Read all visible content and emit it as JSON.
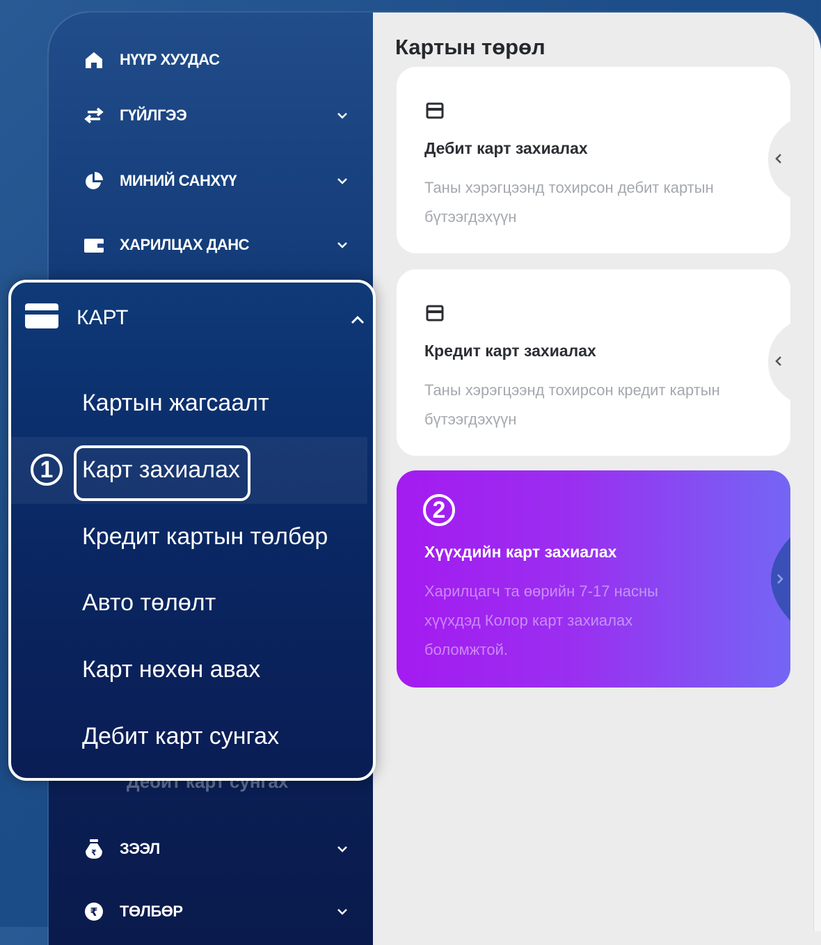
{
  "sidebar": {
    "items": [
      {
        "label": "НҮҮР ХУУДАС",
        "icon": "home-icon"
      },
      {
        "label": "ГҮЙЛГЭЭ",
        "icon": "transfer-icon"
      },
      {
        "label": "МИНИЙ САНХҮҮ",
        "icon": "pie-chart-icon"
      },
      {
        "label": "ХАРИЛЦАХ ДАНС",
        "icon": "wallet-icon"
      },
      {
        "label": "ЗЭЭЛ",
        "icon": "money-bag-icon"
      },
      {
        "label": "ТӨЛБӨР",
        "icon": "payment-icon"
      }
    ],
    "ghost_sub_label": "Дебит карт сунгах"
  },
  "card_menu": {
    "label": "КАРТ",
    "badge": "1",
    "items": [
      {
        "label": "Картын жагсаалт"
      },
      {
        "label": "Карт захиалах"
      },
      {
        "label": "Кредит картын төлбөр"
      },
      {
        "label": "Авто төлөлт"
      },
      {
        "label": "Карт нөхөн авах"
      },
      {
        "label": "Дебит карт сунгах"
      }
    ]
  },
  "main": {
    "title": "Картын төрөл",
    "cards": [
      {
        "title": "Дебит карт захиалах",
        "desc": "Таны хэрэгцээнд тохирсон дебит картын бүтээгдэхүүн"
      },
      {
        "title": "Кредит карт захиалах",
        "desc": "Таны хэрэгцээнд тохирсон кредит картын бүтээгдэхүүн"
      },
      {
        "title": "Хүүхдийн карт захиалах",
        "desc": "Харилцагч та өөрийн 7-17 насны хүүхдэд Колор карт захиалах боломжтой.",
        "badge": "2"
      }
    ]
  },
  "colors": {
    "kids_card_start": "#a41bf0",
    "kids_card_end": "#7466f4",
    "sidebar_top": "#214d8a",
    "sidebar_bottom": "#0a1a4c"
  }
}
